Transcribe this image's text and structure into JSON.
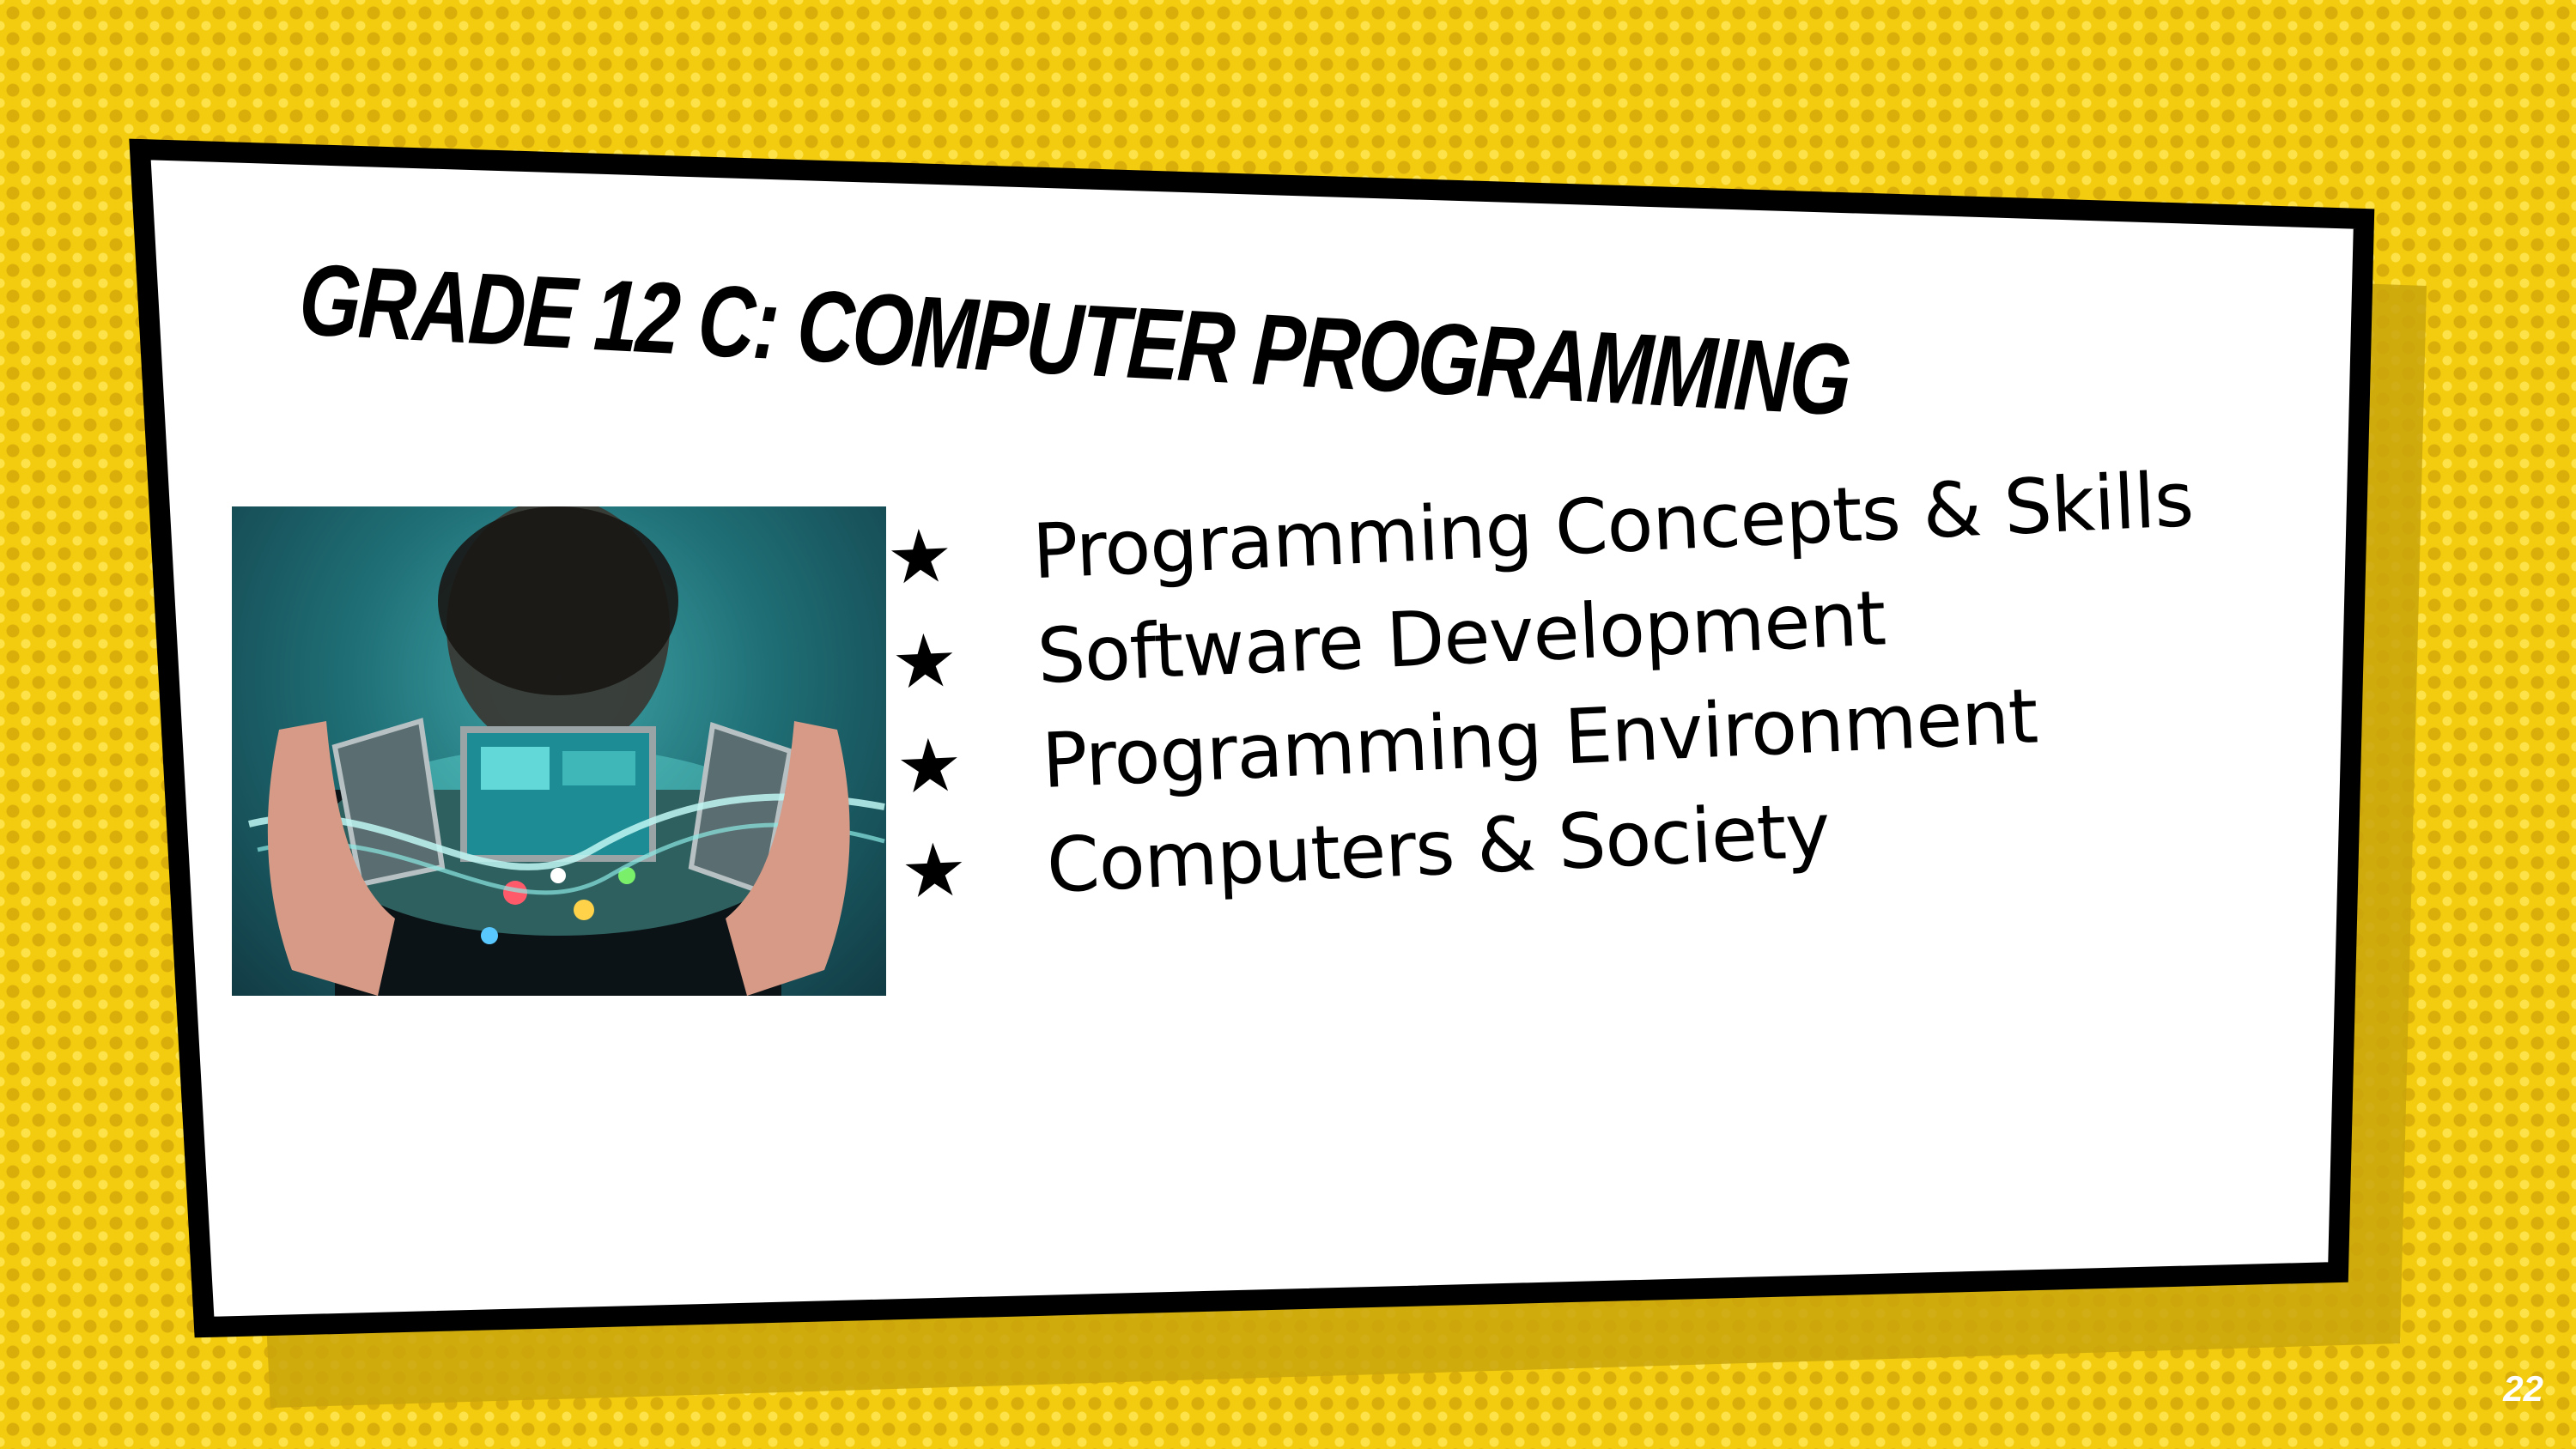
{
  "slide": {
    "title": "Grade 12 C:  Computer Programming",
    "bullets": [
      {
        "icon": "star-icon",
        "text": "Programming Concepts & Skills"
      },
      {
        "icon": "star-icon",
        "text": "Software Development"
      },
      {
        "icon": "star-icon",
        "text": "Programming Environment"
      },
      {
        "icon": "star-icon",
        "text": "Computers & Society"
      }
    ],
    "bullet_symbol": "★",
    "page_number": "22"
  },
  "colors": {
    "background": "#f3cc0f",
    "dots": "#d9ae0b",
    "card": "#ffffff",
    "border": "#000000",
    "shadow": "#c9a40c"
  }
}
